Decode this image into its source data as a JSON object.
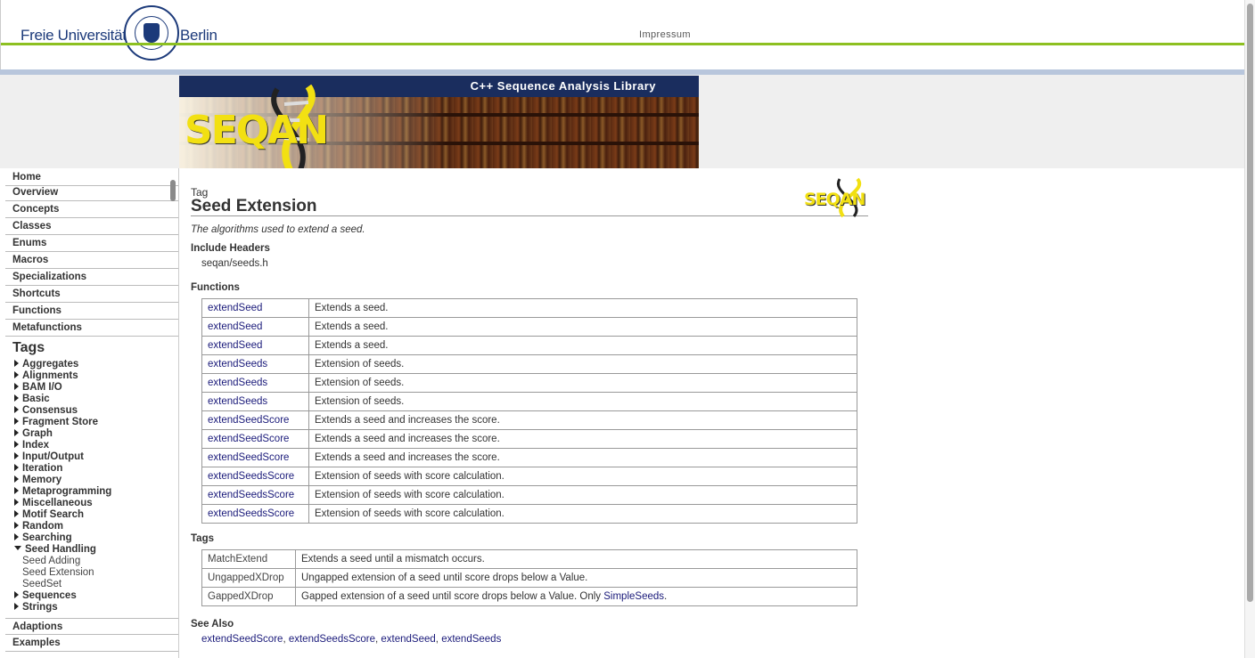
{
  "header": {
    "university_left": "Freie Universität",
    "university_right": "Berlin",
    "impressum": "Impressum"
  },
  "banner": {
    "tagline": "C++ Sequence Analysis Library",
    "logo_text": "SEQAN"
  },
  "sidebar": {
    "top_items": [
      "Home",
      "Overview",
      "Concepts",
      "Classes",
      "Enums",
      "Macros",
      "Specializations",
      "Shortcuts",
      "Functions",
      "Metafunctions"
    ],
    "tags_heading": "Tags",
    "tags": [
      "Aggregates",
      "Alignments",
      "BAM I/O",
      "Basic",
      "Consensus",
      "Fragment Store",
      "Graph",
      "Index",
      "Input/Output",
      "Iteration",
      "Memory",
      "Metaprogramming",
      "Miscellaneous",
      "Motif Search",
      "Random",
      "Searching",
      "Seed Handling"
    ],
    "seed_handling_children": [
      "Seed Adding",
      "Seed Extension",
      "SeedSet"
    ],
    "tags_after": [
      "Sequences",
      "Strings"
    ],
    "bottom_items": [
      "Adaptions",
      "Examples"
    ]
  },
  "main": {
    "kind": "Tag",
    "title": "Seed Extension",
    "summary": "The algorithms used to extend a seed.",
    "include_heading": "Include Headers",
    "include_value": "seqan/seeds.h",
    "functions_heading": "Functions",
    "functions": [
      {
        "name": "extendSeed",
        "desc": "Extends a seed."
      },
      {
        "name": "extendSeed",
        "desc": "Extends a seed."
      },
      {
        "name": "extendSeed",
        "desc": "Extends a seed."
      },
      {
        "name": "extendSeeds",
        "desc": "Extension of seeds."
      },
      {
        "name": "extendSeeds",
        "desc": "Extension of seeds."
      },
      {
        "name": "extendSeeds",
        "desc": "Extension of seeds."
      },
      {
        "name": "extendSeedScore",
        "desc": "Extends a seed and increases the score."
      },
      {
        "name": "extendSeedScore",
        "desc": "Extends a seed and increases the score."
      },
      {
        "name": "extendSeedScore",
        "desc": "Extends a seed and increases the score."
      },
      {
        "name": "extendSeedsScore",
        "desc": "Extension of seeds with score calculation."
      },
      {
        "name": "extendSeedsScore",
        "desc": "Extension of seeds with score calculation."
      },
      {
        "name": "extendSeedsScore",
        "desc": "Extension of seeds with score calculation."
      }
    ],
    "tags_heading": "Tags",
    "tags": [
      {
        "name": "MatchExtend",
        "desc": "Extends a seed until a mismatch occurs.",
        "link": ""
      },
      {
        "name": "UngappedXDrop",
        "desc": "Ungapped extension of a seed until score drops below a Value.",
        "link": ""
      },
      {
        "name": "GappedXDrop",
        "desc": "Gapped extension of a seed until score drops below a Value. Only ",
        "link": "SimpleSeeds",
        "suffix": "."
      }
    ],
    "see_also_heading": "See Also",
    "see_also": [
      "extendSeedScore",
      "extendSeedsScore",
      "extendSeed",
      "extendSeeds"
    ]
  },
  "colors": {
    "accent_green": "#8dc021",
    "banner_navy": "#1a2d5e",
    "link": "#1a1a7a",
    "logo_yellow": "#f2e012"
  }
}
